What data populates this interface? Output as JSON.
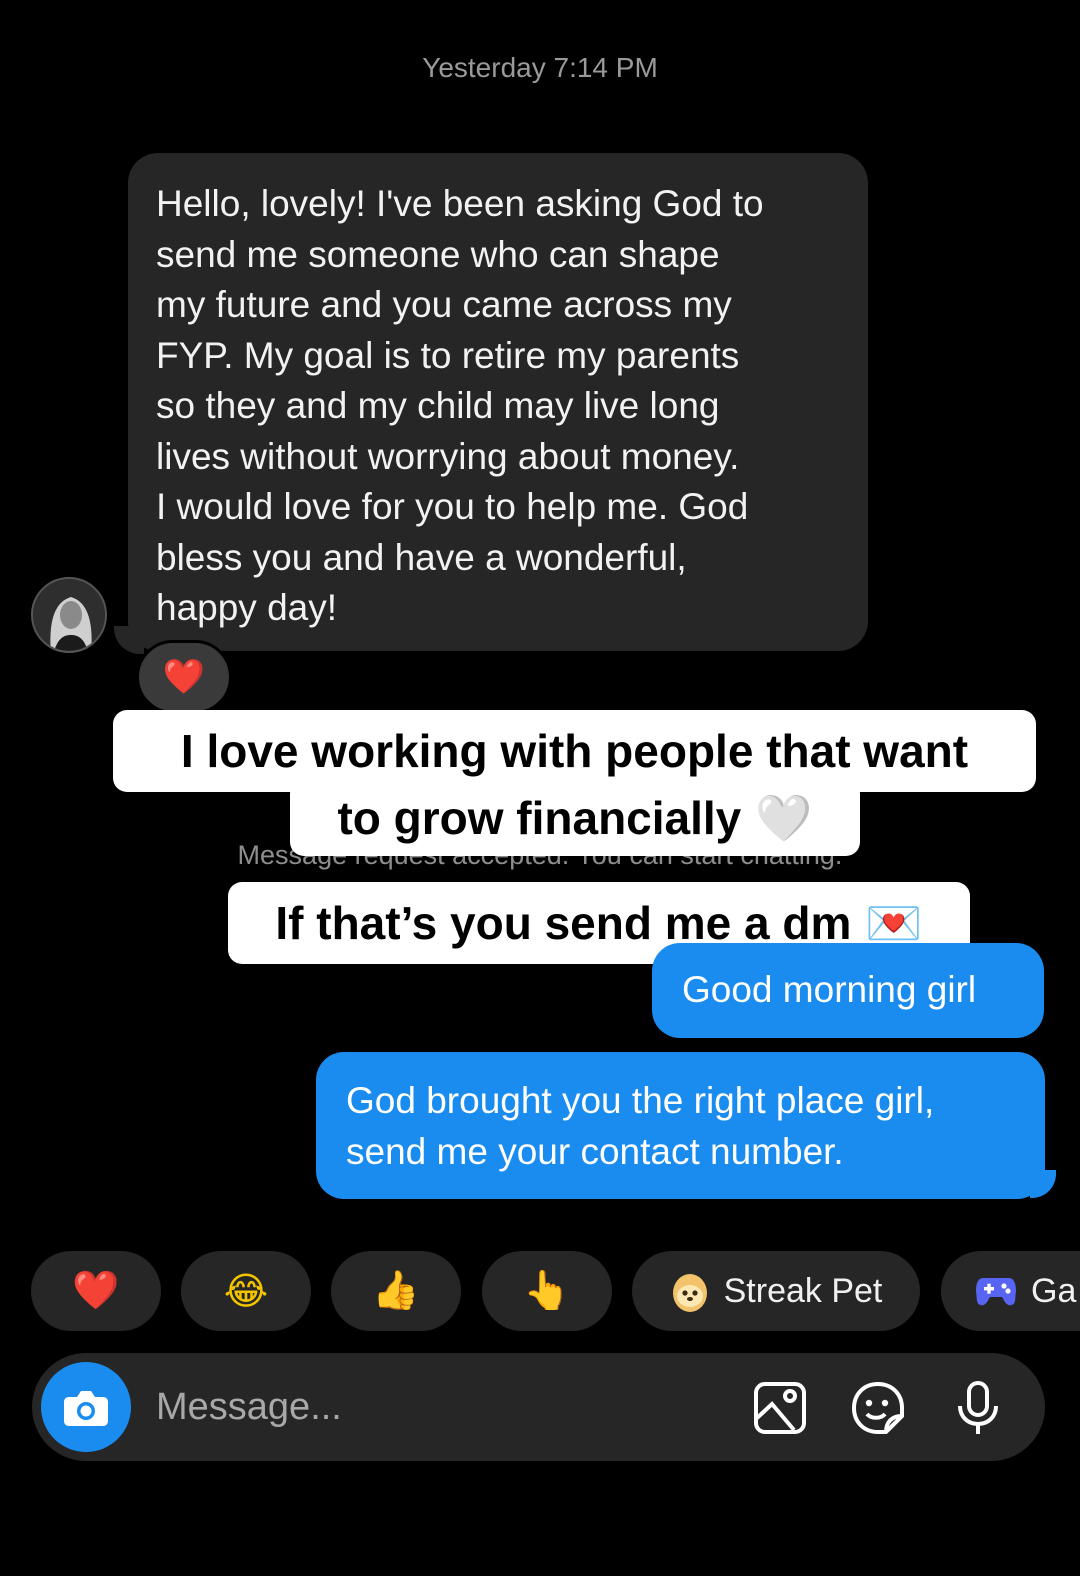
{
  "timestamp": "Yesterday 7:14 PM",
  "incoming": {
    "lines": [
      "Hello, lovely! I've been asking God to",
      "send me someone who can shape",
      "my future and you came across my",
      "FYP. My goal is to retire my parents",
      "so they and my child may live long",
      "lives without worrying about money.",
      "I would love for you to help me. God",
      "bless you and have a wonderful,",
      "happy day!"
    ],
    "reaction": "❤️"
  },
  "system_message": "Message request accepted. You can start chatting.",
  "captions": {
    "line1": "I love working with people that want",
    "line2": "to grow financially",
    "line2_emoji": "🤍",
    "line3": "If that’s you send me a dm",
    "line3_emoji": "💌"
  },
  "outgoing": [
    {
      "lines": [
        "Good morning girl"
      ]
    },
    {
      "lines": [
        "God brought you the right place girl,",
        "send me your contact number."
      ]
    }
  ],
  "quick_replies": {
    "heart": "❤️",
    "laugh": "😂",
    "thumbs_up": "👍",
    "point": "👆",
    "streak_pet_icon": "egg-pet-icon",
    "streak_pet": "Streak Pet",
    "games_icon": "gamepad-icon",
    "games": "Ga"
  },
  "composer": {
    "placeholder": "Message..."
  },
  "colors": {
    "background": "#000000",
    "incoming_bubble": "#262626",
    "outgoing_bubble": "#1a8cf0",
    "accent": "#1a8cf0"
  }
}
